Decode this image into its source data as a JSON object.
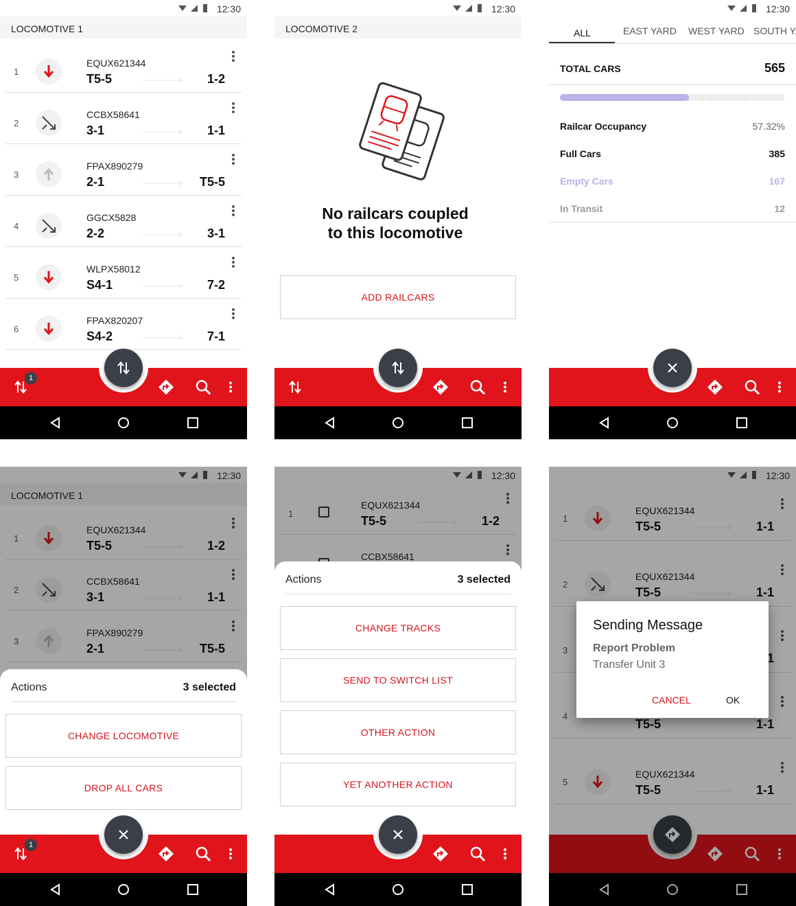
{
  "status": {
    "time": "12:30"
  },
  "colors": {
    "accent": "#e1141b",
    "fab": "#3a3f48",
    "purple": "#b8b3e8"
  },
  "screen1": {
    "title": "LOCOMOTIVE 1",
    "rows": [
      {
        "num": "1",
        "code": "EQUX621344",
        "from": "T5-5",
        "to": "1-2",
        "icon": "arrow-down-icon"
      },
      {
        "num": "2",
        "code": "CCBX58641",
        "from": "3-1",
        "to": "1-1",
        "icon": "shuffle-icon"
      },
      {
        "num": "3",
        "code": "FPAX890279",
        "from": "2-1",
        "to": "T5-5",
        "icon": "arrow-up-icon"
      },
      {
        "num": "4",
        "code": "GGCX5828",
        "from": "2-2",
        "to": "3-1",
        "icon": "shuffle-icon"
      },
      {
        "num": "5",
        "code": "WLPX58012",
        "from": "S4-1",
        "to": "7-2",
        "icon": "arrow-down-icon"
      },
      {
        "num": "6",
        "code": "FPAX820207",
        "from": "S4-2",
        "to": "7-1",
        "icon": "arrow-down-icon"
      }
    ],
    "badge": "1"
  },
  "screen2": {
    "title": "LOCOMOTIVE 2",
    "empty_line1": "No railcars coupled",
    "empty_line2": "to this locomotive",
    "add_button": "ADD RAILCARS"
  },
  "screen3": {
    "tabs": [
      "ALL",
      "EAST YARD",
      "WEST YARD",
      "SOUTH YA"
    ],
    "total_label": "TOTAL CARS",
    "total_value": "565",
    "occupancy_fraction": 0.5732,
    "stats": [
      {
        "label": "Railcar Occupancy",
        "value": "57.32%"
      },
      {
        "label": "Full Cars",
        "value": "385"
      },
      {
        "label": "Empty Cars",
        "value": "167"
      },
      {
        "label": "In Transit",
        "value": "12"
      }
    ]
  },
  "screen4": {
    "title": "LOCOMOTIVE 1",
    "rows": [
      {
        "num": "1",
        "code": "EQUX621344",
        "from": "T5-5",
        "to": "1-2"
      },
      {
        "num": "2",
        "code": "CCBX58641",
        "from": "3-1",
        "to": "1-1"
      },
      {
        "num": "3",
        "code": "FPAX890279",
        "from": "2-1",
        "to": "T5-5"
      }
    ],
    "sheet_title": "Actions",
    "sheet_count": "3 selected",
    "buttons": [
      "CHANGE LOCOMOTIVE",
      "DROP ALL CARS"
    ],
    "badge": "1"
  },
  "screen5": {
    "rows": [
      {
        "num": "1",
        "code": "EQUX621344",
        "from": "T5-5",
        "to": "1-2"
      },
      {
        "num": "2",
        "code": "CCBX58641"
      }
    ],
    "sheet_title": "Actions",
    "sheet_count": "3 selected",
    "buttons": [
      "CHANGE TRACKS",
      "SEND TO SWITCH LIST",
      "OTHER ACTION",
      "YET ANOTHER ACTION"
    ]
  },
  "screen6": {
    "rows": [
      {
        "num": "1",
        "code": "EQUX621344",
        "from": "T5-5",
        "to": "1-1"
      },
      {
        "num": "2",
        "code": "EQUX621344",
        "from": "T5-5",
        "to": "1-1"
      },
      {
        "num": "3",
        "to": "1"
      },
      {
        "num": "4",
        "from": "T5-5",
        "to": "1-1"
      },
      {
        "num": "5",
        "code": "EQUX621344",
        "from": "T5-5",
        "to": "1-1"
      }
    ],
    "dialog": {
      "title": "Sending Message",
      "subtitle": "Report Problem",
      "message": "Transfer Unit 3",
      "cancel": "CANCEL",
      "ok": "OK"
    }
  }
}
